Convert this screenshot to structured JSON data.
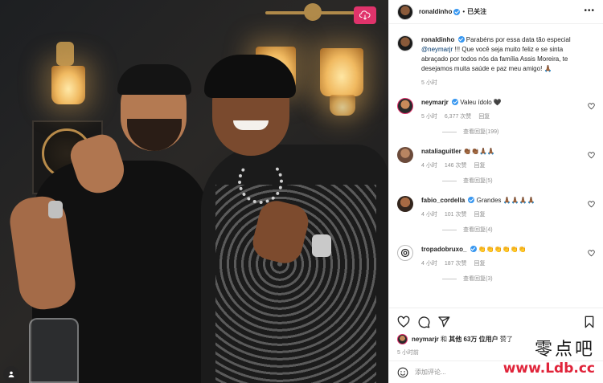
{
  "post": {
    "author": "ronaldinho",
    "follow_status": "已关注",
    "separator": "•",
    "caption_user": "ronaldinho",
    "caption_text": "Parabéns por essa data tão especial",
    "caption_mention": "@neymarjr",
    "caption_rest": "!!! Que você seja muito feliz e se sinta abraçado por todos nós da família Assis Moreira, te desejamos muita saúde e paz meu amigo! 🙏🏾",
    "caption_time": "5 小时"
  },
  "comments": [
    {
      "user": "neymarjr",
      "text": "Valeu ídolo 🖤",
      "time": "5 小时",
      "likes": "6,377 次赞",
      "reply": "回复",
      "view_replies": "查看回复(199)"
    },
    {
      "user": "nataliaguitler",
      "text": "👏🏾👏🏾🙏🏾🙏🏾",
      "time": "4 小时",
      "likes": "146 次赞",
      "reply": "回复",
      "view_replies": "查看回复(5)"
    },
    {
      "user": "fabio_cordella",
      "text": "Grandes 🙏🏾🙏🏾🙏🏾🙏🏾",
      "time": "4 小时",
      "likes": "101 次赞",
      "reply": "回复",
      "view_replies": "查看回复(4)"
    },
    {
      "user": "tropadobruxo_",
      "text": "👏👏👏👏👏👏",
      "time": "4 小时",
      "likes": "187 次赞",
      "reply": "回复",
      "view_replies": "查看回复(3)"
    }
  ],
  "likes_line": {
    "user": "neymarjr",
    "middle": "和",
    "others": "其他 63万 位用户",
    "suffix": "赞了"
  },
  "post_time": "5 小时前",
  "add_comment_placeholder": "添加评论...",
  "watermark": {
    "line1": "零点吧",
    "line2": "www.Ldb.cc"
  },
  "icons": [
    "heart-icon",
    "comment-icon",
    "share-icon",
    "bookmark-icon",
    "emoji-icon",
    "more-icon",
    "verified-icon",
    "threads-icon",
    "tag-icon",
    "download-icon"
  ],
  "colors": {
    "link": "#00376b",
    "verified": "#3897f0",
    "muted": "#8e8e8e",
    "watermark_red": "#e0243a",
    "download_btn": "#e0336b"
  }
}
